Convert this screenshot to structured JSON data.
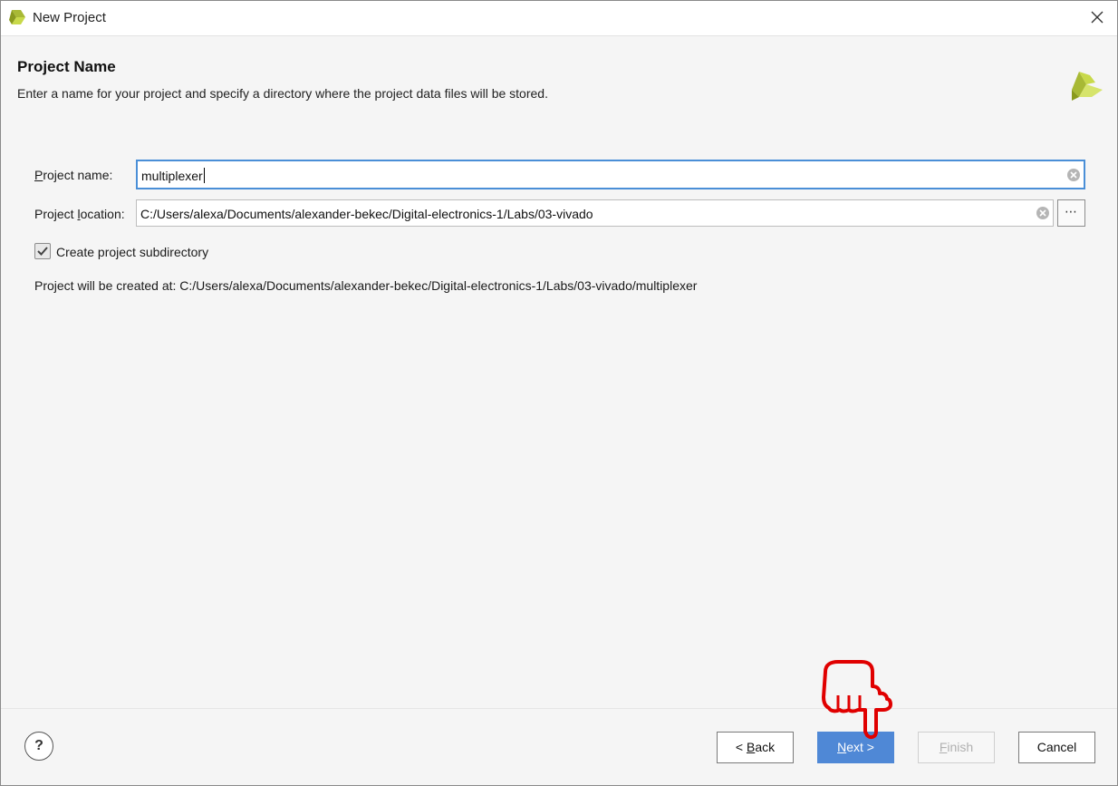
{
  "window": {
    "title": "New Project"
  },
  "page": {
    "title": "Project Name",
    "description": "Enter a name for your project and specify a directory where the project data files will be stored."
  },
  "form": {
    "name_label": "Project name:",
    "name_label_underline": "P",
    "name_label_rest": "roject name:",
    "name_value": "multiplexer",
    "location_label_pre": "Project ",
    "location_label_underline": "l",
    "location_label_post": "ocation:",
    "location_value": "C:/Users/alexa/Documents/alexander-bekec/Digital-electronics-1/Labs/03-vivado",
    "browse_label": "⋯",
    "subdir_label": "Create project subdirectory",
    "subdir_checked": true,
    "created_at_label": "Project will be created at: C:/Users/alexa/Documents/alexander-bekec/Digital-electronics-1/Labs/03-vivado/multiplexer"
  },
  "footer": {
    "help_label": "?",
    "back_pre": "< ",
    "back_underline": "B",
    "back_post": "ack",
    "next_underline": "N",
    "next_post": "ext >",
    "finish_underline": "F",
    "finish_post": "inish",
    "cancel_label": "Cancel"
  },
  "colors": {
    "accent": "#4f88d6",
    "focus": "#4a8fd7",
    "pointer": "#e00000",
    "logo_light": "#c8d94a",
    "logo_dark": "#8a9a1e"
  },
  "icons": [
    "vivado-logo-icon",
    "close-icon",
    "clear-icon",
    "checkmark-icon",
    "help-icon",
    "pointing-hand-icon"
  ]
}
